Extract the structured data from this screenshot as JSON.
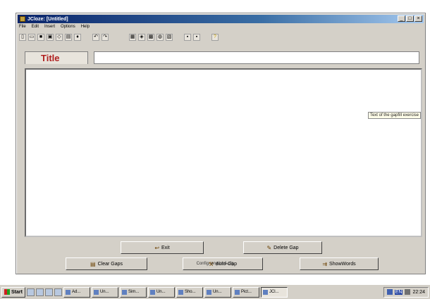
{
  "window": {
    "title": "JCloze: [Untitled]"
  },
  "menu": [
    "File",
    "Edit",
    "Insert",
    "Options",
    "Help"
  ],
  "toolbar_icons": [
    "new-file-icon",
    "open-folder-icon",
    "save-icon",
    "save-as-icon",
    "diamond-icon",
    "export-icon",
    "html-icon",
    "undo-icon",
    "redo-icon",
    "tool-1-icon",
    "tool-2-icon",
    "tool-3-icon",
    "tool-4-icon",
    "tool-5-icon",
    "tool-6-icon",
    "help-icon"
  ],
  "title_label": "Title",
  "hint": "Text of the gapfill exercise",
  "buttons": {
    "exit": "Exit",
    "delete_gap": "Delete Gap",
    "clear_gaps": "Clear Gaps",
    "auto_gap": "Auto-Gap",
    "show_words": "ShowWords"
  },
  "config": "Config: english6.cfg",
  "taskbar": {
    "start": "Start",
    "tasks": [
      "Ad...",
      "Un...",
      "Sim...",
      "Un...",
      "Sho...",
      "Un...",
      "Pict...",
      "JCl..."
    ],
    "lang": "EN",
    "clock": "22:24"
  }
}
